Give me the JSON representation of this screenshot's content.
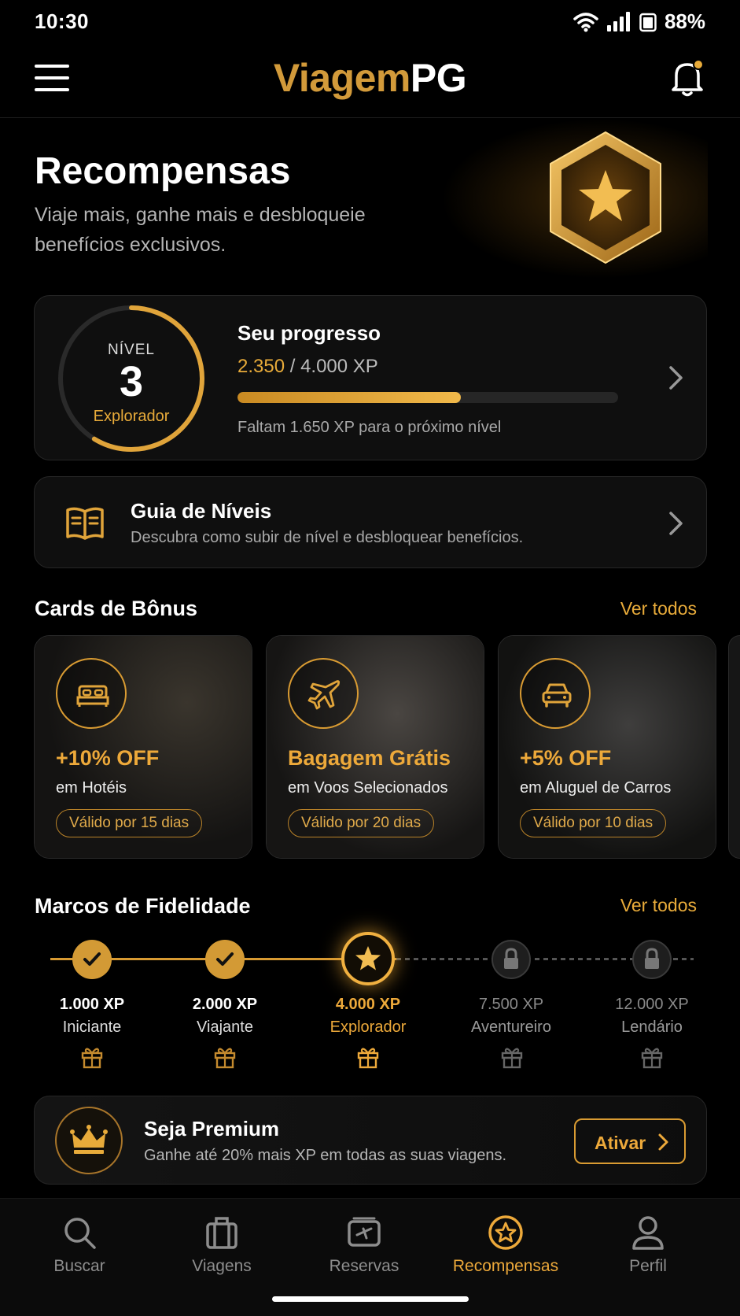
{
  "status_bar": {
    "time": "10:30",
    "battery": "88%"
  },
  "header": {
    "logo_part1": "Viagem",
    "logo_part2": "PG"
  },
  "hero": {
    "title": "Recompensas",
    "subtitle": "Viaje mais, ganhe mais e desbloqueie benefícios exclusivos."
  },
  "level": {
    "label": "NÍVEL",
    "number": "3",
    "tier": "Explorador",
    "progress_title": "Seu progresso",
    "xp_current": "2.350",
    "xp_total": "/ 4.000 XP",
    "progress_fraction": 0.5875,
    "note": "Faltam 1.650 XP para o próximo nível"
  },
  "guide": {
    "title": "Guia de Níveis",
    "description": "Descubra como subir de nível e desbloquear benefícios."
  },
  "bonus_section": {
    "title": "Cards de Bônus",
    "see_all": "Ver todos"
  },
  "bonus_cards": [
    {
      "icon": "bed-icon",
      "headline": "+10% OFF",
      "subtitle": "em Hotéis",
      "validity": "Válido por 15 dias"
    },
    {
      "icon": "plane-icon",
      "headline": "Bagagem Grátis",
      "subtitle": "em Voos Selecionados",
      "validity": "Válido por 20 dias"
    },
    {
      "icon": "car-icon",
      "headline": "+5% OFF",
      "subtitle": "em Aluguel de Carros",
      "validity": "Válido por 10 dias"
    }
  ],
  "milestones_section": {
    "title": "Marcos de Fidelidade",
    "see_all": "Ver todos"
  },
  "milestones": [
    {
      "xp": "1.000 XP",
      "name": "Iniciante",
      "state": "completed"
    },
    {
      "xp": "2.000 XP",
      "name": "Viajante",
      "state": "completed"
    },
    {
      "xp": "4.000 XP",
      "name": "Explorador",
      "state": "current"
    },
    {
      "xp": "7.500 XP",
      "name": "Aventureiro",
      "state": "locked"
    },
    {
      "xp": "12.000 XP",
      "name": "Lendário",
      "state": "locked"
    }
  ],
  "premium": {
    "title": "Seja Premium",
    "description": "Ganhe até 20% mais XP em todas as suas viagens.",
    "button": "Ativar"
  },
  "tabs": [
    {
      "label": "Buscar",
      "icon": "search-icon"
    },
    {
      "label": "Viagens",
      "icon": "suitcase-icon"
    },
    {
      "label": "Reservas",
      "icon": "tickets-icon"
    },
    {
      "label": "Recompensas",
      "icon": "star-badge-icon",
      "active": true
    },
    {
      "label": "Perfil",
      "icon": "user-icon"
    }
  ],
  "colors": {
    "accent": "#e8ab3a",
    "background": "#000000",
    "card": "#0f0f0f"
  }
}
